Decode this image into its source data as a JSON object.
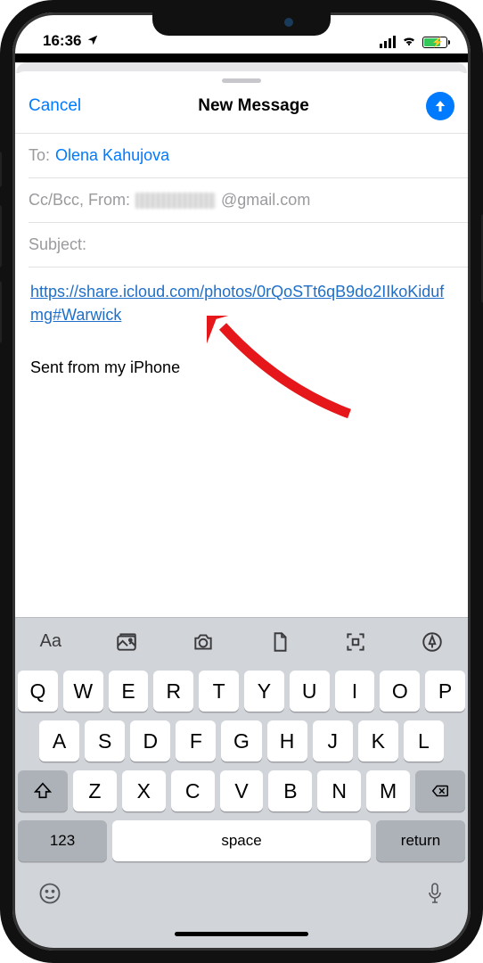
{
  "status": {
    "time": "16:36"
  },
  "header": {
    "cancel": "Cancel",
    "title": "New Message"
  },
  "fields": {
    "to_label": "To:",
    "to_value": "Olena Kahujova",
    "ccbcc_label": "Cc/Bcc, From:",
    "from_domain": "@gmail.com",
    "subject_label": "Subject:"
  },
  "body": {
    "link": "https://share.icloud.com/photos/0rQoSTt6qB9do2IIkoKidufmg#Warwick",
    "signature": "Sent from my iPhone"
  },
  "keyboard": {
    "row1": [
      "Q",
      "W",
      "E",
      "R",
      "T",
      "Y",
      "U",
      "I",
      "O",
      "P"
    ],
    "row2": [
      "A",
      "S",
      "D",
      "F",
      "G",
      "H",
      "J",
      "K",
      "L"
    ],
    "row3": [
      "Z",
      "X",
      "C",
      "V",
      "B",
      "N",
      "M"
    ],
    "numKey": "123",
    "space": "space",
    "return": "return",
    "format": "Aa"
  }
}
